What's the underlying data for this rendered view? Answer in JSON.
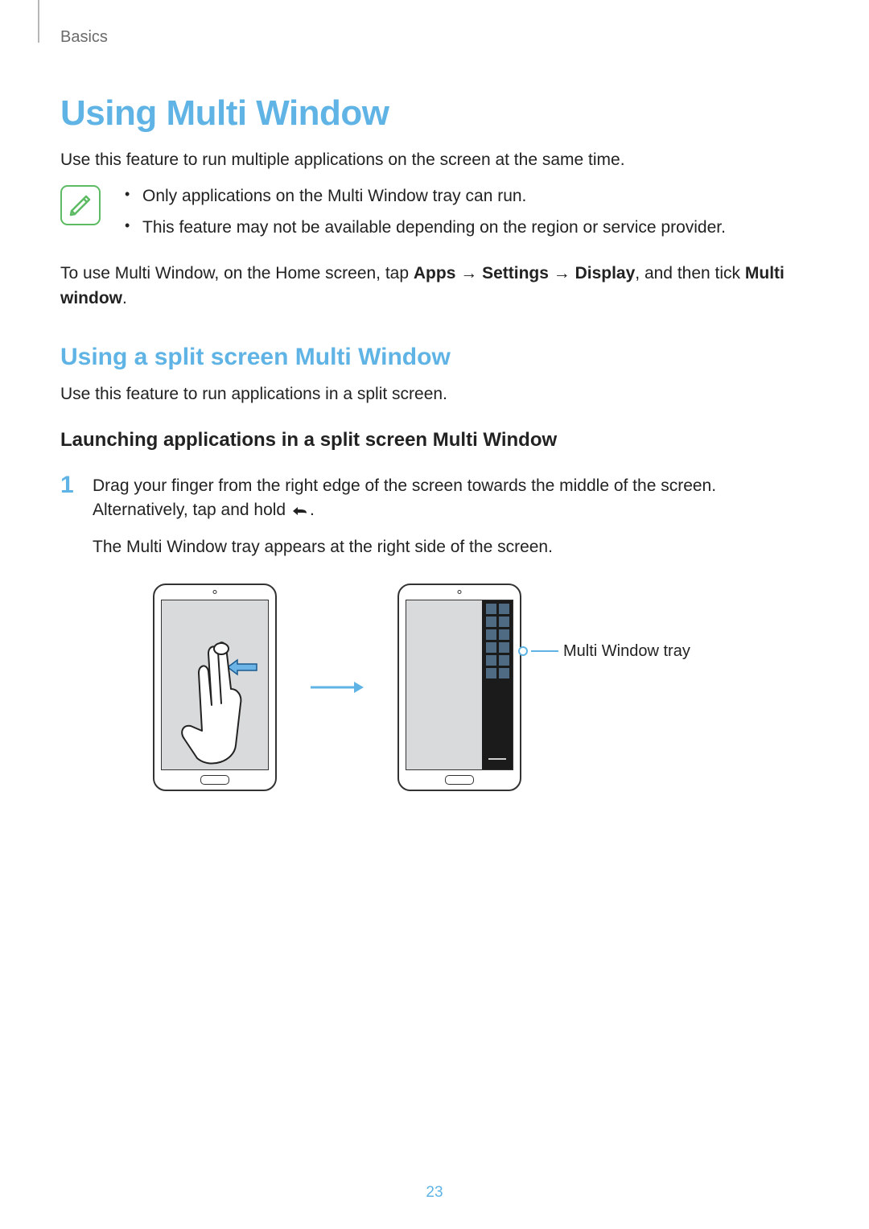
{
  "breadcrumb": "Basics",
  "title": "Using Multi Window",
  "intro": "Use this feature to run multiple applications on the screen at the same time.",
  "notes": [
    "Only applications on the Multi Window tray can run.",
    "This feature may not be available depending on the region or service provider."
  ],
  "instruction_prefix": "To use Multi Window, on the Home screen, tap ",
  "instruction_path": [
    "Apps",
    "Settings",
    "Display"
  ],
  "instruction_suffix": ", and then tick ",
  "instruction_bold_tail": "Multi window",
  "subhead": "Using a split screen Multi Window",
  "sub_intro": "Use this feature to run applications in a split screen.",
  "subsub": "Launching applications in a split screen Multi Window",
  "step": {
    "num": "1",
    "line1a": "Drag your finger from the right edge of the screen towards the middle of the screen. Alternatively, tap and hold ",
    "line1b": ".",
    "line2": "The Multi Window tray appears at the right side of the screen."
  },
  "callout": "Multi Window tray",
  "page_number": "23"
}
